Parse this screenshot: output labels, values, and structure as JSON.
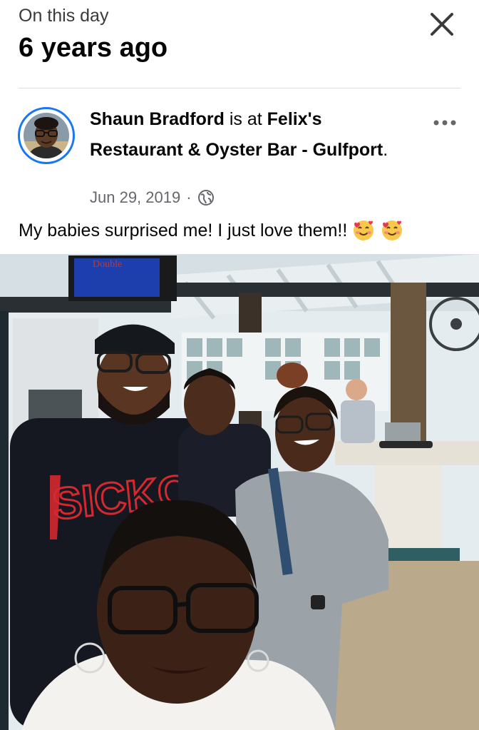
{
  "header": {
    "eyebrow": "On this day",
    "title": "6 years ago",
    "close_icon": "close-icon"
  },
  "post": {
    "author": "Shaun Bradford",
    "connector": " is at ",
    "place": "Felix's Restaurant & Oyster Bar - Gulfport",
    "place_suffix": ".",
    "date": "Jun 29, 2019",
    "separator": "·",
    "privacy_icon": "globe-icon",
    "more_icon": "more-horizontal-icon",
    "text": "My babies surprised me! I just love them!!",
    "emojis": [
      "smiling-face-with-hearts",
      "smiling-face-with-hearts"
    ],
    "photo_sign_text": "Double"
  }
}
